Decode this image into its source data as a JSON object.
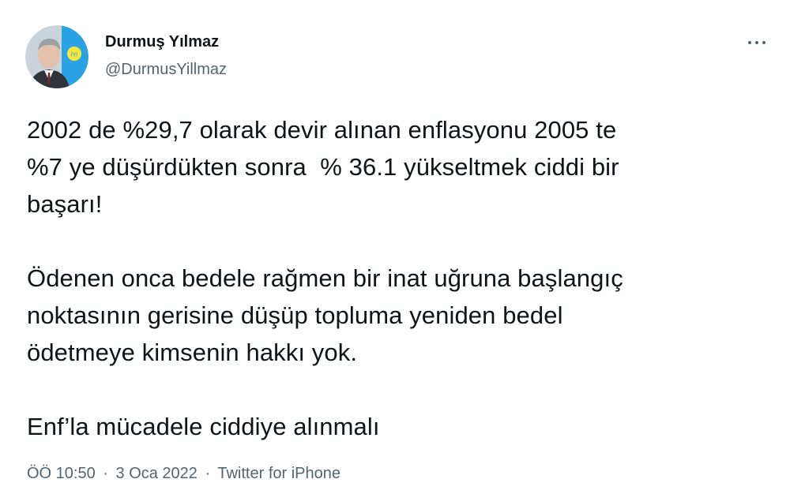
{
  "author": {
    "name": "Durmuş Yılmaz",
    "handle": "@DurmusYillmaz",
    "avatar_icon": "profile-photo",
    "avatar_badge_text": "İYİ"
  },
  "menu": {
    "icon": "more-horizontal-icon"
  },
  "tweet": {
    "paragraphs": [
      "2002 de %29,7 olarak devir alınan enflasyonu 2005 te\n%7 ye düşürdükten sonra  % 36.1 yükseltmek ciddi bir\nbaşarı!",
      "Ödenen onca bedele rağmen bir inat uğruna başlangıç\nnoktasının gerisine düşüp topluma yeniden bedel\nödetmeye kimsenin hakkı yok.",
      "Enf’la mücadele ciddiye alınmalı"
    ]
  },
  "meta": {
    "time": "ÖÖ 10:50",
    "separator": "·",
    "date": "3 Oca 2022",
    "source": "Twitter for iPhone"
  },
  "colors": {
    "text_primary": "#0f1419",
    "text_secondary": "#536471",
    "badge_blue": "#2aa3e6",
    "badge_yellow": "#f6e83a"
  }
}
